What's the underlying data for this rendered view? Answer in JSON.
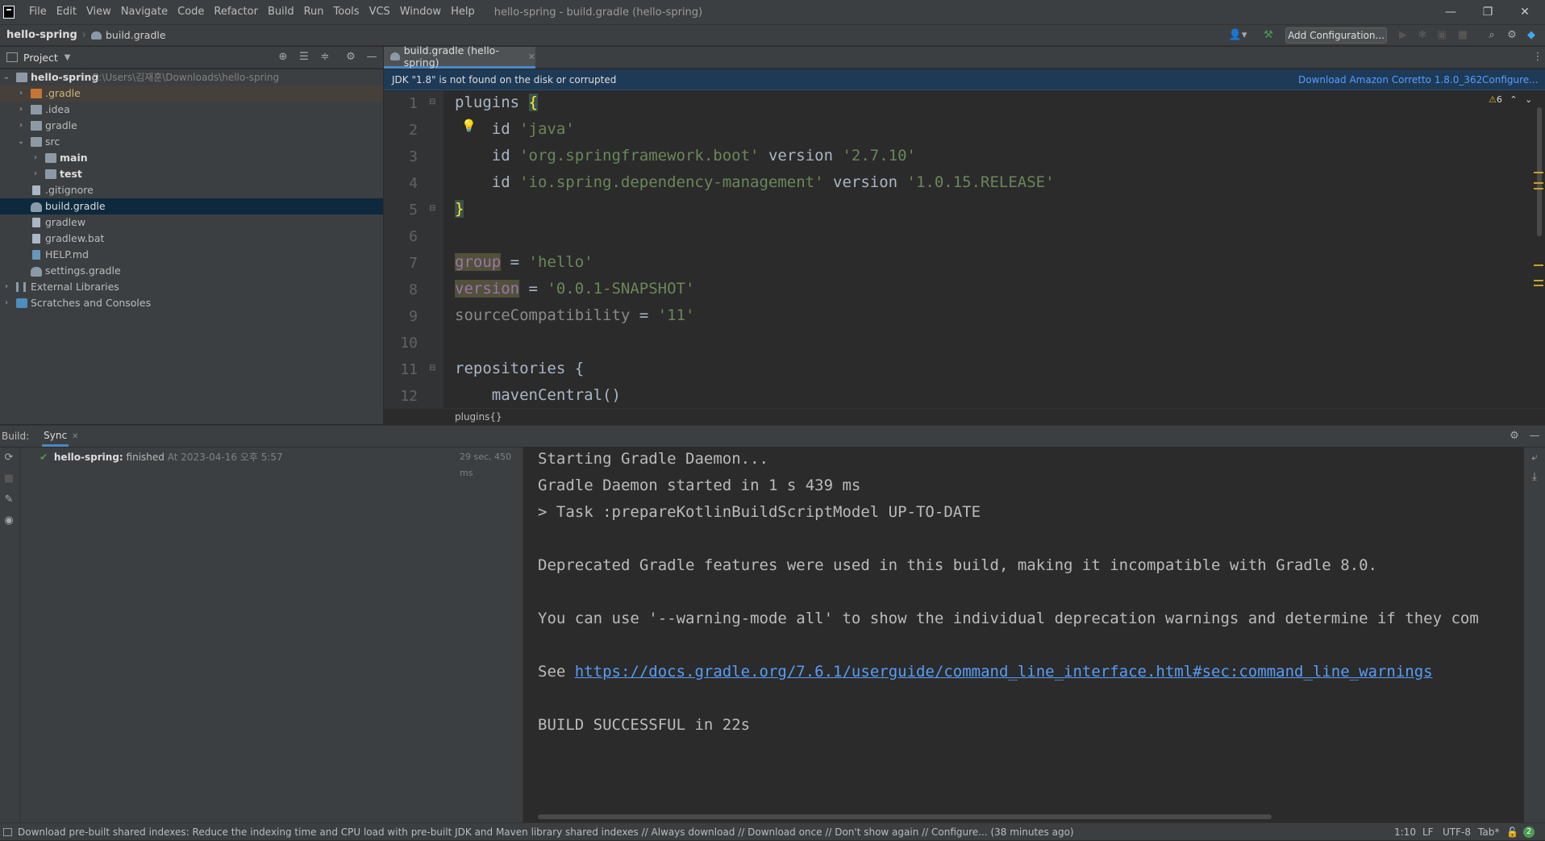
{
  "menu": [
    "File",
    "Edit",
    "View",
    "Navigate",
    "Code",
    "Refactor",
    "Build",
    "Run",
    "Tools",
    "VCS",
    "Window",
    "Help"
  ],
  "window_title": "hello-spring - build.gradle (hello-spring)",
  "nav": {
    "project": "hello-spring",
    "file": "build.gradle",
    "add_config": "Add Configuration..."
  },
  "project_panel": {
    "title": "Project",
    "root_name": "hello-spring",
    "root_path": "C:\\Users\\김재훈\\Downloads\\hello-spring",
    "items": [
      ".gradle",
      ".idea",
      "gradle",
      "src",
      "main",
      "test",
      ".gitignore",
      "build.gradle",
      "gradlew",
      "gradlew.bat",
      "HELP.md",
      "settings.gradle",
      "External Libraries",
      "Scratches and Consoles"
    ]
  },
  "editor": {
    "tab": "build.gradle (hello-spring)",
    "jdk_message": "JDK \"1.8\" is not found on the disk or corrupted",
    "download_link": "Download Amazon Corretto 1.8.0_362",
    "configure_link": "Configure...",
    "warnings": "6",
    "line_numbers": [
      "1",
      "2",
      "3",
      "4",
      "5",
      "6",
      "7",
      "8",
      "9",
      "10",
      "11",
      "12"
    ],
    "breadcrumb": "plugins{}"
  },
  "build": {
    "label": "Build:",
    "tab": "Sync",
    "task_name": "hello-spring:",
    "task_status": "finished",
    "task_time": "At 2023-04-16 오후 5:57",
    "duration": "29 sec, 450 ms",
    "console": [
      "Starting Gradle Daemon...",
      "Gradle Daemon started in 1 s 439 ms",
      "> Task :prepareKotlinBuildScriptModel UP-TO-DATE",
      "",
      "Deprecated Gradle features were used in this build, making it incompatible with Gradle 8.0.",
      "",
      "You can use '--warning-mode all' to show the individual deprecation warnings and determine if they com",
      "",
      "See ",
      "",
      "BUILD SUCCESSFUL in 22s"
    ],
    "link": "https://docs.gradle.org/7.6.1/userguide/command_line_interface.html#sec:command_line_warnings"
  },
  "status": {
    "message": "Download pre-built shared indexes: Reduce the indexing time and CPU load with pre-built JDK and Maven library shared indexes // Always download // Download once // Don't show again // Configure... (38 minutes ago)",
    "position": "1:10",
    "line_sep": "LF",
    "encoding": "UTF-8",
    "indent": "Tab*",
    "notifications": "2"
  },
  "colors": {
    "accent": "#4a88c7",
    "success": "#499c54",
    "keyword": "#cc7832",
    "string": "#6a8759",
    "link": "#589df6"
  }
}
